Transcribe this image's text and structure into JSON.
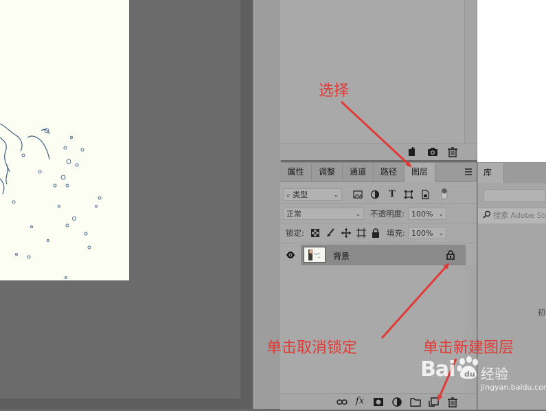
{
  "layers_panel": {
    "tabs": [
      "属性",
      "调整",
      "通道",
      "路径",
      "图层"
    ],
    "active_tab": "图层",
    "filter_kind": "类型",
    "blend_mode": "正常",
    "opacity_label": "不透明度:",
    "opacity_value": "100%",
    "lock_label": "锁定:",
    "fill_label": "填充:",
    "fill_value": "100%",
    "layers": [
      {
        "name": "背景",
        "visible": true,
        "locked": true
      }
    ]
  },
  "library_panel": {
    "tab": "库",
    "search_placeholder": "搜索 Adobe Stock",
    "partial_text": "初"
  },
  "annotations": {
    "select": "选择",
    "unlock": "单击取消锁定",
    "new_layer": "单击新建图层",
    "color": "#e03a37"
  },
  "watermark": {
    "brand": "Bai",
    "product": "经验",
    "url": "jingyan.baidu.com"
  },
  "icons": {
    "history_footer": [
      "new-doc-from-state-icon",
      "camera-icon",
      "trash-icon"
    ],
    "layers_footer": [
      "link-icon",
      "fx-icon",
      "mask-icon",
      "adjustment-icon",
      "folder-icon",
      "new-layer-icon",
      "trash-icon"
    ],
    "filter": [
      "image-filter-icon",
      "adjust-filter-icon",
      "text-filter-icon",
      "shape-filter-icon",
      "smart-object-filter-icon",
      "filter-toggle-icon"
    ],
    "lock": [
      "lock-pixels-icon",
      "lock-brush-icon",
      "lock-move-icon",
      "lock-artboard-icon",
      "lock-all-icon"
    ]
  }
}
